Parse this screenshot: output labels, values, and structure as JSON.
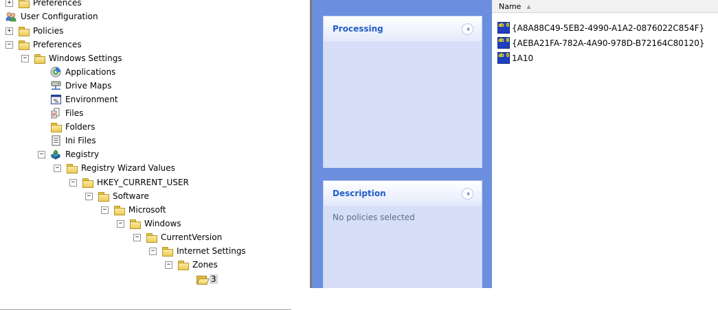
{
  "tree": {
    "items": [
      {
        "label": "Preferences",
        "expander": "+",
        "icon": "folder-icon"
      },
      {
        "label": "User Configuration",
        "expander": "",
        "icon": "users-icon"
      },
      {
        "label": "Policies",
        "expander": "+",
        "icon": "folder-icon"
      },
      {
        "label": "Preferences",
        "expander": "−",
        "icon": "folder-icon"
      },
      {
        "label": "Windows Settings",
        "expander": "−",
        "icon": "folder-icon"
      },
      {
        "label": "Applications",
        "expander": "",
        "icon": "applications-icon"
      },
      {
        "label": "Drive Maps",
        "expander": "",
        "icon": "drive-maps-icon"
      },
      {
        "label": "Environment",
        "expander": "",
        "icon": "environment-icon"
      },
      {
        "label": "Files",
        "expander": "",
        "icon": "files-icon"
      },
      {
        "label": "Folders",
        "expander": "",
        "icon": "folders-icon"
      },
      {
        "label": "Ini Files",
        "expander": "",
        "icon": "ini-files-icon"
      },
      {
        "label": "Registry",
        "expander": "−",
        "icon": "registry-icon"
      },
      {
        "label": "Registry Wizard Values",
        "expander": "−",
        "icon": "folder-icon"
      },
      {
        "label": "HKEY_CURRENT_USER",
        "expander": "−",
        "icon": "folder-icon"
      },
      {
        "label": "Software",
        "expander": "−",
        "icon": "folder-icon"
      },
      {
        "label": "Microsoft",
        "expander": "−",
        "icon": "folder-icon"
      },
      {
        "label": "Windows",
        "expander": "−",
        "icon": "folder-icon"
      },
      {
        "label": "CurrentVersion",
        "expander": "−",
        "icon": "folder-icon"
      },
      {
        "label": "Internet Settings",
        "expander": "−",
        "icon": "folder-icon"
      },
      {
        "label": "Zones",
        "expander": "−",
        "icon": "folder-icon"
      },
      {
        "label": "3",
        "expander": "",
        "icon": "folder-open-icon"
      }
    ]
  },
  "taskpane": {
    "processing": {
      "title": "Processing",
      "collapse_glyph": "«"
    },
    "description": {
      "title": "Description",
      "collapse_glyph": "«",
      "text": "No policies selected"
    }
  },
  "list": {
    "column_name": "Name",
    "sort_glyph": "▲",
    "icon_text": "ab\n01",
    "items": [
      {
        "label": "{A8A88C49-5EB2-4990-A1A2-0876022C854F}"
      },
      {
        "label": "{AEBA21FA-782A-4A90-978D-B72164C80120}"
      },
      {
        "label": "1A10"
      }
    ]
  },
  "colors": {
    "taskpane_bg": "#6b8fde",
    "panel_title": "#215dc6",
    "panel_body": "#d6dff7"
  }
}
